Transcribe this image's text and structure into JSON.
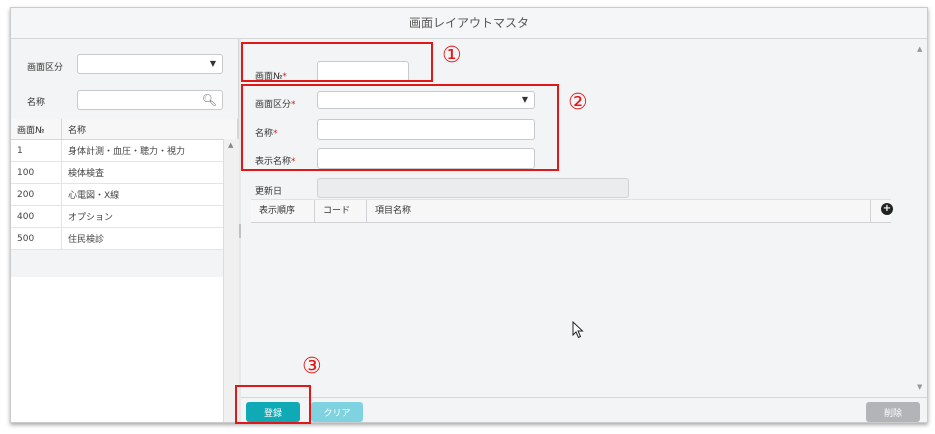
{
  "window": {
    "title": "画面レイアウトマスタ"
  },
  "left": {
    "filter": {
      "category_label": "画面区分",
      "category_value": "",
      "name_label": "名称",
      "name_value": ""
    },
    "table": {
      "headers": [
        "画面№",
        "名称"
      ],
      "rows": [
        [
          "1",
          "身体計測・血圧・聴力・視力"
        ],
        [
          "100",
          "検体検査"
        ],
        [
          "200",
          "心電図・X線"
        ],
        [
          "400",
          "オプション"
        ],
        [
          "500",
          "住民検診"
        ]
      ]
    }
  },
  "form": {
    "screen_no_label": "画面№",
    "screen_no_value": "",
    "category_label": "画面区分",
    "category_value": "",
    "name_label": "名称",
    "name_value": "",
    "display_name_label": "表示名称",
    "display_name_value": "",
    "updated_label": "更新日",
    "updated_value": "",
    "required_mark": "*"
  },
  "grid": {
    "headers": [
      "表示順序",
      "コード",
      "項目名称"
    ],
    "add_icon": "plus-circle-icon"
  },
  "footer": {
    "register_label": "登録",
    "clear_label": "クリア",
    "delete_label": "削除"
  },
  "annotations": [
    "①",
    "②",
    "③"
  ],
  "colors": {
    "register": "#10a9b6",
    "clear": "#7fd3e0",
    "delete": "#b2b4b7",
    "annotation": "#e01818"
  }
}
